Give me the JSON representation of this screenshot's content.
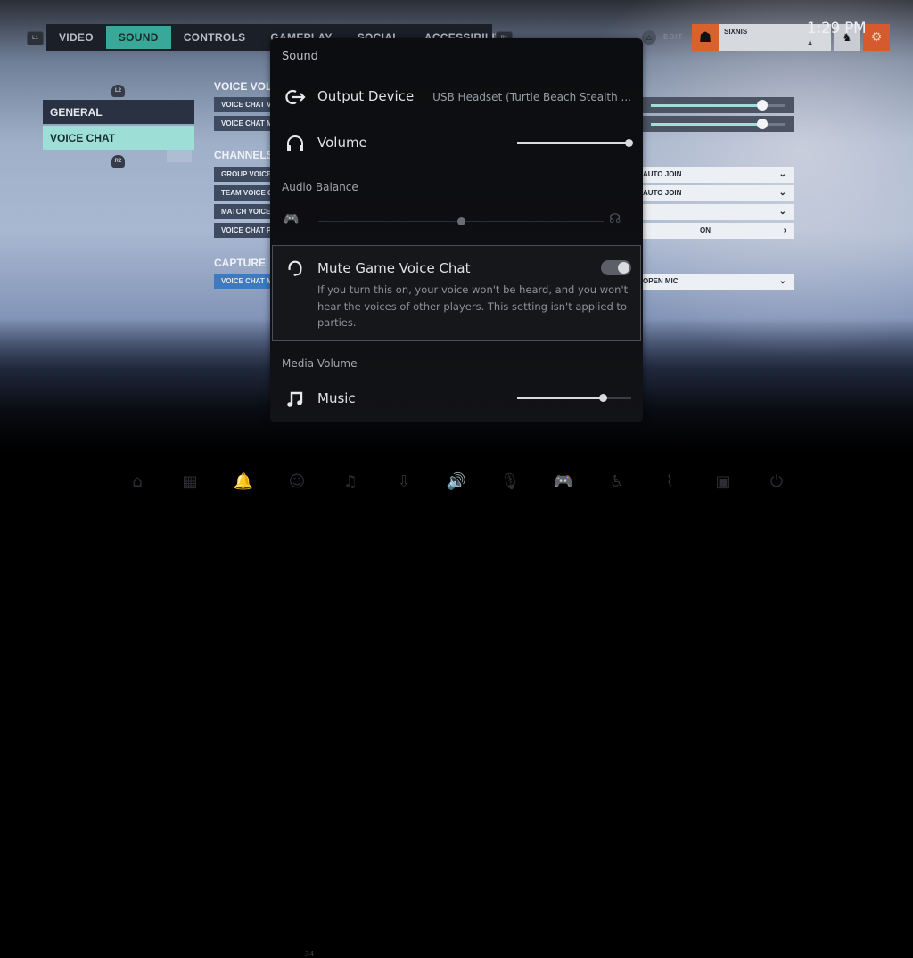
{
  "game_settings": {
    "tab_left_hint": "L1",
    "tab_right_hint": "R1",
    "tabs": [
      {
        "label": "VIDEO",
        "active": false
      },
      {
        "label": "SOUND",
        "active": true
      },
      {
        "label": "CONTROLS",
        "active": false
      },
      {
        "label": "GAMEPLAY",
        "active": false
      },
      {
        "label": "SOCIAL",
        "active": false
      },
      {
        "label": "ACCESSIBILITY",
        "active": false
      }
    ],
    "nav_up_hint": "L2",
    "nav_down_hint": "R2",
    "nav": [
      {
        "label": "GENERAL",
        "active": false
      },
      {
        "label": "VOICE CHAT",
        "active": true
      }
    ],
    "sections": {
      "voice_volume": {
        "title": "VOICE VOLUME",
        "rows": [
          {
            "label": "VOICE CHAT VOLUME",
            "value": 0.83
          },
          {
            "label": "VOICE CHAT MIC VOLUME",
            "value": 0.83
          }
        ]
      },
      "channels": {
        "title": "CHANNELS",
        "rows": [
          {
            "label": "GROUP VOICE CHAT",
            "value": "AUTO JOIN"
          },
          {
            "label": "TEAM VOICE CHAT",
            "value": "AUTO JOIN"
          },
          {
            "label": "MATCH VOICE CHAT",
            "value": ""
          },
          {
            "label": "VOICE CHAT PUSH TO TALK",
            "value": "ON"
          }
        ]
      },
      "capture": {
        "title": "CAPTURE",
        "rows": [
          {
            "label": "VOICE CHAT MIC",
            "value": "OPEN MIC"
          }
        ]
      }
    }
  },
  "header": {
    "edit_label": "EDIT",
    "username": "SIXNIS",
    "clock": "1:29 PM"
  },
  "sound_panel": {
    "title": "Sound",
    "output_device": {
      "label": "Output Device",
      "value": "USB Headset (Turtle Beach Stealth ..."
    },
    "volume": {
      "label": "Volume",
      "value": 1.0
    },
    "audio_balance": {
      "label": "Audio Balance",
      "value": 0.5
    },
    "mute_game_voice_chat": {
      "label": "Mute Game Voice Chat",
      "enabled": true,
      "description": "If you turn this on, your voice won't be heard, and you won't hear the voices of other players. This setting isn't applied to parties."
    },
    "media_volume": {
      "label": "Media Volume"
    },
    "music": {
      "label": "Music",
      "value": 0.75
    }
  },
  "dock": {
    "items": [
      {
        "name": "home-icon",
        "glyph": "⌂",
        "active": false
      },
      {
        "name": "game-library-icon",
        "glyph": "▦",
        "active": false
      },
      {
        "name": "notifications-icon",
        "glyph": "🔔",
        "active": false
      },
      {
        "name": "game-base-icon",
        "glyph": "☺",
        "active": false,
        "badge": "34"
      },
      {
        "name": "music-icon",
        "glyph": "♫",
        "active": false
      },
      {
        "name": "downloads-icon",
        "glyph": "⇩",
        "active": false
      },
      {
        "name": "sound-icon",
        "glyph": "🔊",
        "active": true
      },
      {
        "name": "mic-icon",
        "glyph": "🎙",
        "active": false
      },
      {
        "name": "controller-icon",
        "glyph": "🎮",
        "active": false
      },
      {
        "name": "accessibility-icon",
        "glyph": "♿",
        "active": false
      },
      {
        "name": "network-icon",
        "glyph": "⌇",
        "active": false
      },
      {
        "name": "remote-play-icon",
        "glyph": "▣",
        "active": false
      },
      {
        "name": "power-icon",
        "glyph": "⏻",
        "active": false
      }
    ]
  }
}
